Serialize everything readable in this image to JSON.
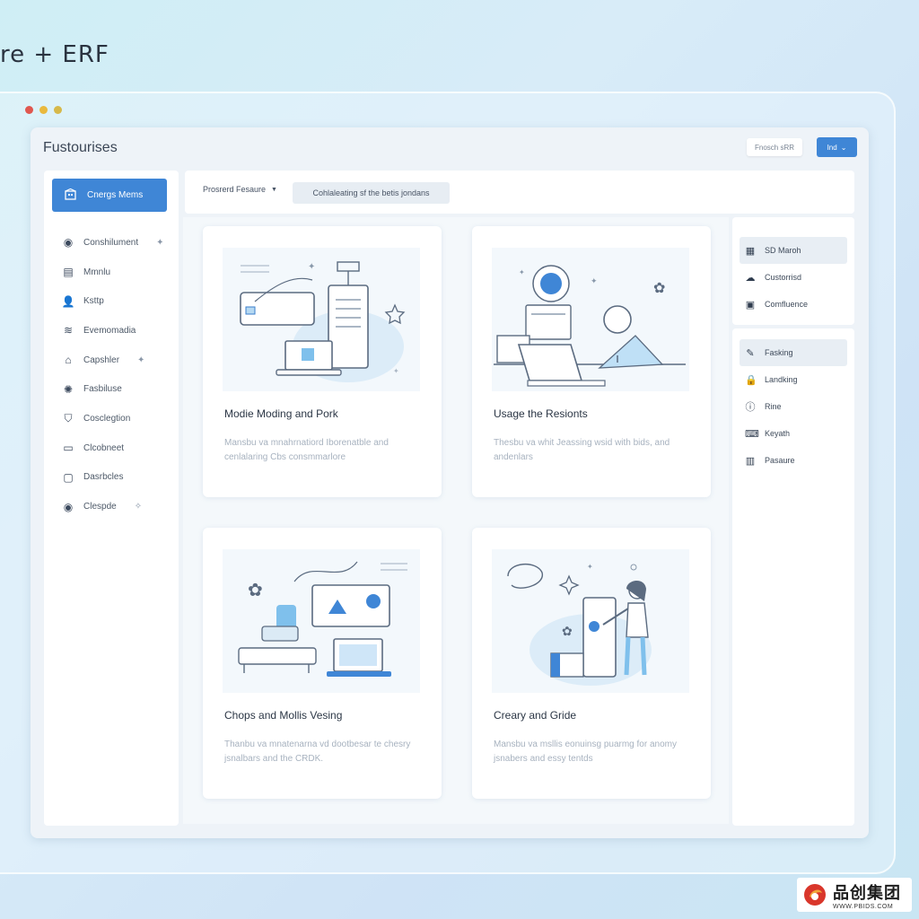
{
  "header_text": "re + ERF",
  "window": {
    "title": "Fustourises",
    "login_label": "Fnosch sRR",
    "primary_label": "Ind"
  },
  "sidebar": {
    "active": {
      "label": "Cnergs Mems",
      "icon": "building-icon"
    },
    "items": [
      {
        "label": "Conshilument",
        "icon": "circle-icon",
        "tail": "✦"
      },
      {
        "label": "Mmnlu",
        "icon": "chart-icon"
      },
      {
        "label": "Ksttp",
        "icon": "user-icon"
      },
      {
        "label": "Evemomadia",
        "icon": "database-icon"
      },
      {
        "label": "Capshler",
        "icon": "home-icon",
        "tail": "✦"
      },
      {
        "label": "Fasbiluse",
        "icon": "settings-icon"
      },
      {
        "label": "Cosclegtion",
        "icon": "shield-icon"
      },
      {
        "label": "Clcobneet",
        "icon": "monitor-icon"
      },
      {
        "label": "Dasrbcles",
        "icon": "card-icon"
      },
      {
        "label": "Clespde",
        "icon": "circle-icon",
        "tail": "✧"
      }
    ]
  },
  "toolbar": {
    "dropdown_label": "Prosrerd Fesaure",
    "filter_label": "Cohlaleating sf the betis jondans"
  },
  "cards": [
    {
      "title": "Modie Moding and Pork",
      "desc": "Mansbu va mnahrnatiord Iborenatble and cenlalaring Cbs consmmarlore"
    },
    {
      "title": "Usage the Resionts",
      "desc": "Thesbu va whit Jeassing wsid with bids, and andenlars"
    },
    {
      "title": "Chops and Mollis Vesing",
      "desc": "Thanbu va mnatenarna vd dootbesar te chesry jsnalbars and the CRDK."
    },
    {
      "title": "Creary and Gride",
      "desc": "Mansbu va msllis eonuinsg puarmg for anomy jsnabers and essy tentds"
    }
  ],
  "right_panel_top": [
    {
      "label": "SD Maroh",
      "icon": "calendar-icon",
      "highlight": true
    },
    {
      "label": "Custorrisd",
      "icon": "cloud-icon"
    },
    {
      "label": "Comfluence",
      "icon": "document-icon"
    }
  ],
  "right_panel_bottom": [
    {
      "label": "Fasking",
      "icon": "pencil-icon",
      "highlight": true
    },
    {
      "label": "Landking",
      "icon": "lock-icon"
    },
    {
      "label": "Rine",
      "icon": "info-icon"
    },
    {
      "label": "Keyath",
      "icon": "keyboard-icon"
    },
    {
      "label": "Pasaure",
      "icon": "bars-icon"
    }
  ],
  "watermark": {
    "name": "品创集团",
    "url": "WWW.PBIDS.COM"
  }
}
